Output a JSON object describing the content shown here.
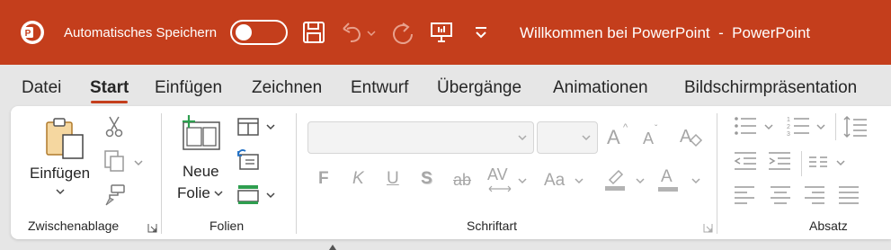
{
  "titlebar": {
    "autosave_label": "Automatisches Speichern",
    "autosave_on": false,
    "title": "Willkommen bei PowerPoint  -  PowerPoint",
    "bg_color": "#c43e1c",
    "icons": [
      "powerpoint-logo-icon",
      "save-icon",
      "undo-icon",
      "redo-icon",
      "present-icon",
      "customize-qat-icon"
    ]
  },
  "tabs": [
    {
      "label": "Datei"
    },
    {
      "label": "Start",
      "active": true
    },
    {
      "label": "Einfügen"
    },
    {
      "label": "Zeichnen"
    },
    {
      "label": "Entwurf"
    },
    {
      "label": "Übergänge"
    },
    {
      "label": "Animationen"
    },
    {
      "label": "Bildschirmpräsentation"
    }
  ],
  "ribbon": {
    "clipboard": {
      "label": "Zwischenablage",
      "paste_label": "Einfügen",
      "icons": [
        "paste-icon",
        "cut-icon",
        "copy-icon",
        "format-painter-icon",
        "dialog-launcher-icon"
      ]
    },
    "slides": {
      "label": "Folien",
      "new_slide_line1": "Neue",
      "new_slide_line2": "Folie",
      "icons": [
        "new-slide-icon",
        "layout-icon",
        "reset-icon",
        "section-icon"
      ]
    },
    "font": {
      "label": "Schriftart",
      "font_name": "",
      "font_size": "",
      "bold": "F",
      "italic": "K",
      "underline": "U",
      "shadow": "S",
      "strike": "ab",
      "spacing": "AV",
      "case": "Aa",
      "grow": "A",
      "shrink": "A",
      "font_color": "A",
      "icons": [
        "grow-font-icon",
        "shrink-font-icon",
        "clear-formatting-icon",
        "highlight-icon",
        "font-color-icon",
        "dialog-launcher-icon"
      ]
    },
    "paragraph": {
      "label": "Absatz",
      "icons": [
        "bullets-icon",
        "numbering-icon",
        "line-spacing-icon",
        "decrease-indent-icon",
        "increase-indent-icon",
        "columns-icon",
        "align-left-icon",
        "align-center-icon",
        "align-right-icon",
        "justify-icon"
      ]
    }
  }
}
